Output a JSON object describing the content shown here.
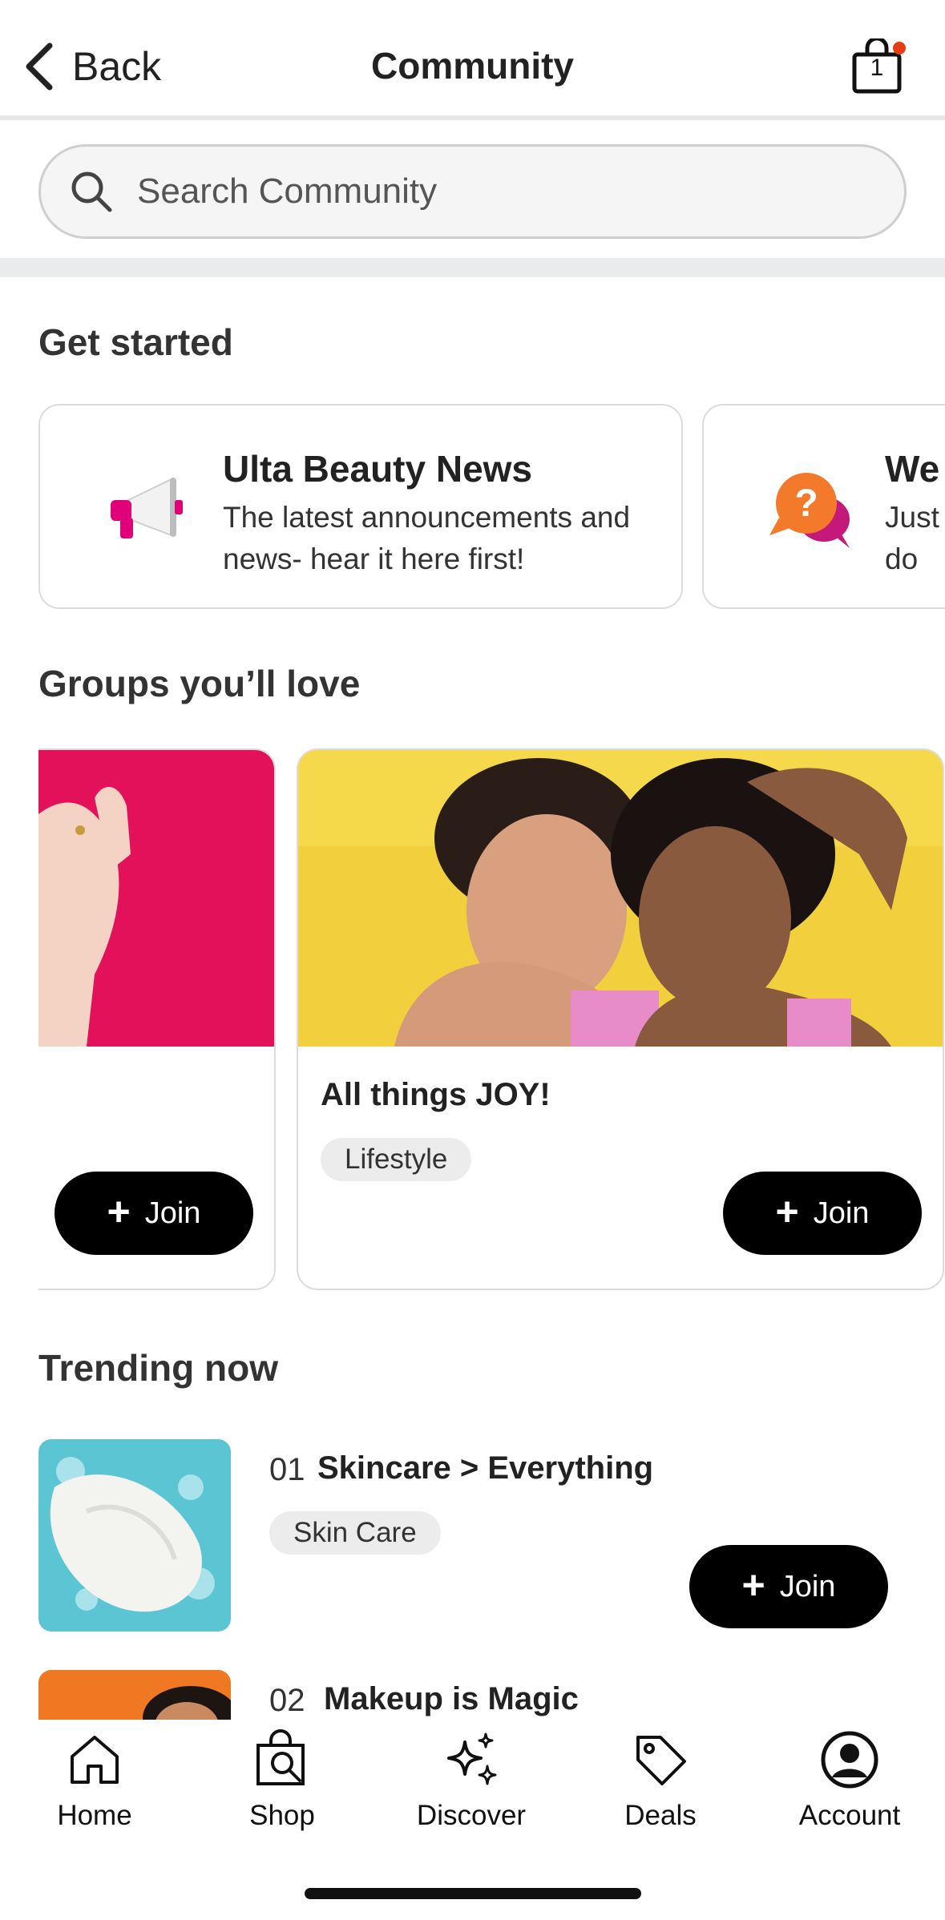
{
  "header": {
    "back_label": "Back",
    "title": "Community",
    "bag_count": "1",
    "bag_badge_color": "#e63c12"
  },
  "search": {
    "placeholder": "Search Community"
  },
  "get_started": {
    "title": "Get started",
    "cards": [
      {
        "title": "Ulta Beauty News",
        "description": "The latest announcements and news- hear it here first!",
        "icon": "megaphone-icon"
      },
      {
        "title": "We",
        "description": "Just to do",
        "icon": "question-bubble-icon"
      }
    ]
  },
  "groups": {
    "title": "Groups you’ll love",
    "items": [
      {
        "name": "",
        "tag": "",
        "join_label": "Join",
        "image": "hand-on-pink-photo"
      },
      {
        "name": "All things JOY!",
        "tag": "Lifestyle",
        "join_label": "Join",
        "image": "two-smiling-women-photo"
      }
    ]
  },
  "trending": {
    "title": "Trending now",
    "items": [
      {
        "rank": "01",
        "name": "Skincare > Everything",
        "tag": "Skin Care",
        "join_label": "Join",
        "image": "cream-swatch-photo"
      },
      {
        "rank": "02",
        "name": "Makeup is Magic",
        "image": "woman-portrait-photo"
      }
    ]
  },
  "nav": {
    "items": [
      {
        "label": "Home",
        "icon": "home-icon"
      },
      {
        "label": "Shop",
        "icon": "shop-bag-icon"
      },
      {
        "label": "Discover",
        "icon": "sparkles-icon"
      },
      {
        "label": "Deals",
        "icon": "tag-icon"
      },
      {
        "label": "Account",
        "icon": "account-icon"
      }
    ]
  },
  "colors": {
    "brand_pink": "#e6005c",
    "accent_orange": "#f47a2b",
    "button_black": "#000000"
  }
}
